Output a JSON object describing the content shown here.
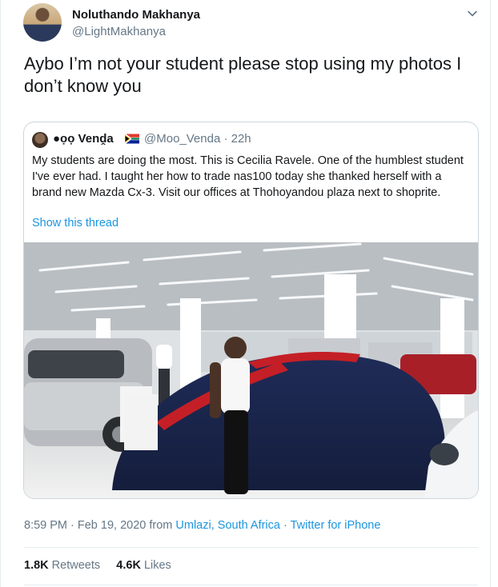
{
  "tweet": {
    "author_name": "Noluthando Makhanya",
    "author_handle": "@LightMakhanya",
    "text": "Aybo I’m not your student please stop using my photos I don’t know you",
    "timestamp": "8:59 PM · Feb 19, 2020 from ",
    "location": "Umlazi, South Africa",
    "separator": " · ",
    "source": "Twitter for iPhone",
    "retweets_count": "1.8K",
    "retweets_label": "Retweets",
    "likes_count": "4.6K",
    "likes_label": "Likes",
    "menu_icon": "chevron-down-icon"
  },
  "quoted": {
    "author_name": "●ọọ Venḓa",
    "author_handle": "@Moo_Venda · 22h",
    "flag_icon": "south-africa-flag-icon",
    "text": "My students are doing the most. This is Cecilia Ravele. One of the humblest student I've ever had. I taught her how to trade nas100 today she thanked herself with a brand new Mazda Cx-3. Visit our offices at Thohoyandou plaza next to shoprite.",
    "show_thread": "Show this thread"
  },
  "colors": {
    "link": "#1b95e0",
    "muted": "#657786",
    "border": "#ccd6dd"
  }
}
